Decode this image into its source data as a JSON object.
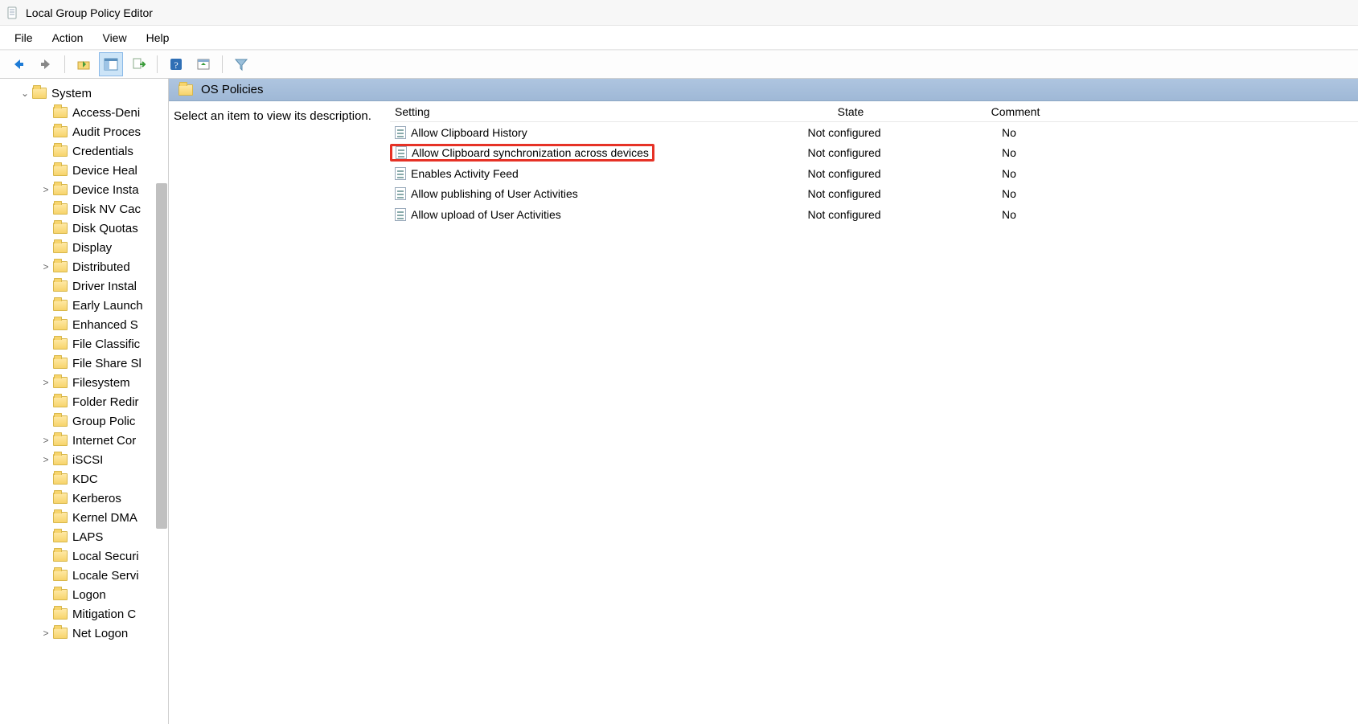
{
  "window": {
    "title": "Local Group Policy Editor"
  },
  "menubar": [
    "File",
    "Action",
    "View",
    "Help"
  ],
  "tree": {
    "root": {
      "label": "System"
    },
    "items": [
      {
        "label": "Access-Deni",
        "expander": ""
      },
      {
        "label": "Audit Proces",
        "expander": ""
      },
      {
        "label": "Credentials",
        "expander": ""
      },
      {
        "label": "Device Heal",
        "expander": ""
      },
      {
        "label": "Device Insta",
        "expander": ">"
      },
      {
        "label": "Disk NV Cac",
        "expander": ""
      },
      {
        "label": "Disk Quotas",
        "expander": ""
      },
      {
        "label": "Display",
        "expander": ""
      },
      {
        "label": "Distributed",
        "expander": ">"
      },
      {
        "label": "Driver Instal",
        "expander": ""
      },
      {
        "label": "Early Launch",
        "expander": ""
      },
      {
        "label": "Enhanced S",
        "expander": ""
      },
      {
        "label": "File Classific",
        "expander": ""
      },
      {
        "label": "File Share Sl",
        "expander": ""
      },
      {
        "label": "Filesystem",
        "expander": ">"
      },
      {
        "label": "Folder Redir",
        "expander": ""
      },
      {
        "label": "Group Polic",
        "expander": ""
      },
      {
        "label": "Internet Cor",
        "expander": ">"
      },
      {
        "label": "iSCSI",
        "expander": ">"
      },
      {
        "label": "KDC",
        "expander": ""
      },
      {
        "label": "Kerberos",
        "expander": ""
      },
      {
        "label": "Kernel DMA",
        "expander": ""
      },
      {
        "label": "LAPS",
        "expander": ""
      },
      {
        "label": "Local Securi",
        "expander": ""
      },
      {
        "label": "Locale Servi",
        "expander": ""
      },
      {
        "label": "Logon",
        "expander": ""
      },
      {
        "label": "Mitigation C",
        "expander": ""
      },
      {
        "label": "Net Logon",
        "expander": ">"
      }
    ]
  },
  "content": {
    "header": "OS Policies",
    "description_prompt": "Select an item to view its description.",
    "columns": {
      "setting": "Setting",
      "state": "State",
      "comment": "Comment"
    },
    "rows": [
      {
        "setting": "Allow Clipboard History",
        "state": "Not configured",
        "comment": "No",
        "highlight": false
      },
      {
        "setting": "Allow Clipboard synchronization across devices",
        "state": "Not configured",
        "comment": "No",
        "highlight": true
      },
      {
        "setting": "Enables Activity Feed",
        "state": "Not configured",
        "comment": "No",
        "highlight": false
      },
      {
        "setting": "Allow publishing of User Activities",
        "state": "Not configured",
        "comment": "No",
        "highlight": false
      },
      {
        "setting": "Allow upload of User Activities",
        "state": "Not configured",
        "comment": "No",
        "highlight": false
      }
    ]
  }
}
